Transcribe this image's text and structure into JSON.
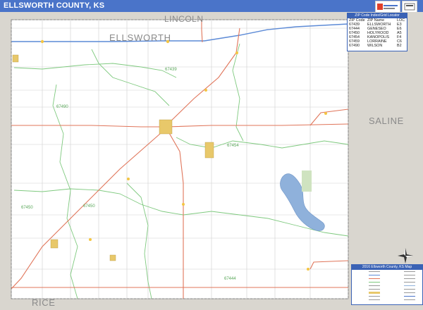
{
  "header": {
    "title": "ELLSWORTH COUNTY, KS"
  },
  "map": {
    "county_name": "ELLSWORTH",
    "neighbors": {
      "north": "LINCOLN",
      "east": "SALINE",
      "south": "RICE"
    },
    "zip_labels": [
      "67439",
      "67490",
      "67454",
      "67450",
      "67450",
      "67444"
    ],
    "colors": {
      "border_gray": "#d9d6cf",
      "highway": "#e0755a",
      "interstate": "#5c8ad6",
      "zip_boundary": "#7ec97e",
      "road": "#c9c9c9",
      "water": "#8fb1db",
      "town": "#e8c86a",
      "header_blue": "#4a74c9"
    }
  },
  "zip_table": {
    "title": "ZIP Code Index/Grid Locator",
    "headers": [
      "ZIP Code",
      "ZIP Name",
      "LOC"
    ],
    "rows": [
      [
        "67439",
        "ELLSWORTH",
        "E3"
      ],
      [
        "67444",
        "GENESEO",
        "E6"
      ],
      [
        "67450",
        "HOLYROOD",
        "A5"
      ],
      [
        "67454",
        "KANOPOLIS",
        "F4"
      ],
      [
        "67459",
        "LORRAINE",
        "C6"
      ],
      [
        "67490",
        "WILSON",
        "B2"
      ]
    ]
  },
  "legend": {
    "title": "2016 Ellsworth County, KS Map"
  },
  "icons": {
    "compass": "compass-rose-icon",
    "logo": "logo-icon"
  }
}
